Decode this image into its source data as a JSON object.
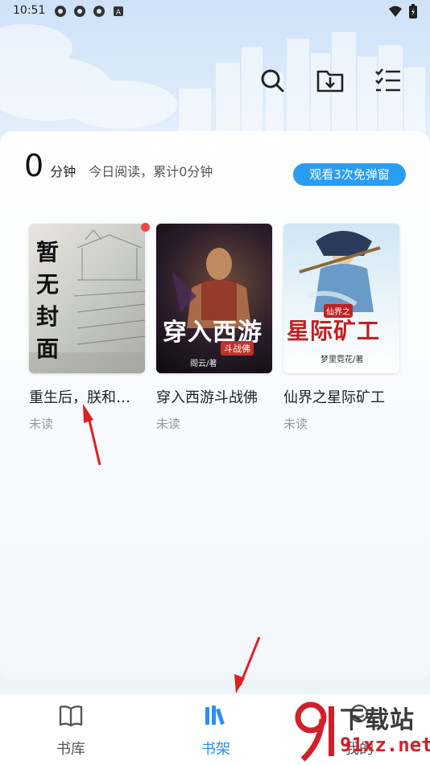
{
  "status_bar": {
    "time": "10:51",
    "left_icons": [
      "app-icon",
      "app-icon",
      "app-icon",
      "a-icon"
    ],
    "right_icons": [
      "wifi-icon",
      "battery-icon"
    ]
  },
  "header_actions": [
    {
      "name": "search-icon"
    },
    {
      "name": "download-folder-icon"
    },
    {
      "name": "manage-list-icon"
    }
  ],
  "reading": {
    "minutes": "0",
    "unit": "分钟",
    "today_text": "今日阅读，累计0分钟",
    "watch_button": "观看3次免弹窗"
  },
  "books": [
    {
      "title": "重生后，朕和…",
      "status": "未读",
      "cover_text": "暂无封面",
      "has_update_dot": true
    },
    {
      "title": "穿入西游斗战佛",
      "status": "未读",
      "cover_title": "穿入西游",
      "cover_sub": "斗战佛",
      "cover_author": "阁云/著"
    },
    {
      "title": "仙界之星际矿工",
      "status": "未读",
      "cover_title": "星际矿工",
      "cover_sub": "仙界之",
      "cover_author": "梦里霓花/著"
    }
  ],
  "tabs": [
    {
      "label": "书库",
      "active": false
    },
    {
      "label": "书架",
      "active": true
    },
    {
      "label": "我的",
      "active": false
    }
  ],
  "colors": {
    "accent": "#2a9df0",
    "active_tab": "#2a8ff0",
    "inactive_tab": "#555555",
    "dot": "#f04848",
    "arrow": "#e02020"
  },
  "watermark": {
    "text": "下载站",
    "domain": "91xz.net"
  }
}
